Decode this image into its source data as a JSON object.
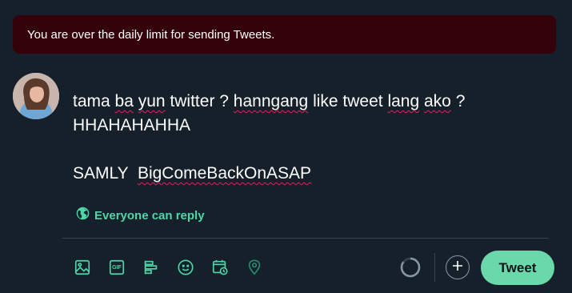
{
  "alert": {
    "message": "You are over the daily limit for sending Tweets."
  },
  "composer": {
    "line1": [
      {
        "text": "tama",
        "spell": false
      },
      {
        "text": " ",
        "spell": false
      },
      {
        "text": "ba",
        "spell": true
      },
      {
        "text": " ",
        "spell": false
      },
      {
        "text": "yun",
        "spell": true
      },
      {
        "text": " twitter ? ",
        "spell": false
      },
      {
        "text": "hanngang",
        "spell": true
      },
      {
        "text": " like tweet ",
        "spell": false
      },
      {
        "text": "lang",
        "spell": true
      },
      {
        "text": " ",
        "spell": false
      },
      {
        "text": "ako",
        "spell": true
      },
      {
        "text": " ?",
        "spell": false
      }
    ],
    "line2": "HHAHAHAHHA",
    "line4_prefix": "SAMLY  ",
    "line4_tag": "BigComeBackOnASAP"
  },
  "reply": {
    "label": "Everyone can reply",
    "icon": "globe-icon"
  },
  "toolbar": {
    "icons": [
      "media-icon",
      "gif-icon",
      "poll-icon",
      "emoji-icon",
      "schedule-icon",
      "location-icon"
    ],
    "gif_text": "GIF"
  },
  "actions": {
    "tweet_label": "Tweet",
    "add_icon": "plus-icon"
  },
  "colors": {
    "background": "#15202b",
    "accent": "#4fd6a7",
    "tweet_button": "#6ad8ab",
    "alert_background": "#33020a",
    "divider": "#38444d"
  },
  "char_progress": 0.85
}
